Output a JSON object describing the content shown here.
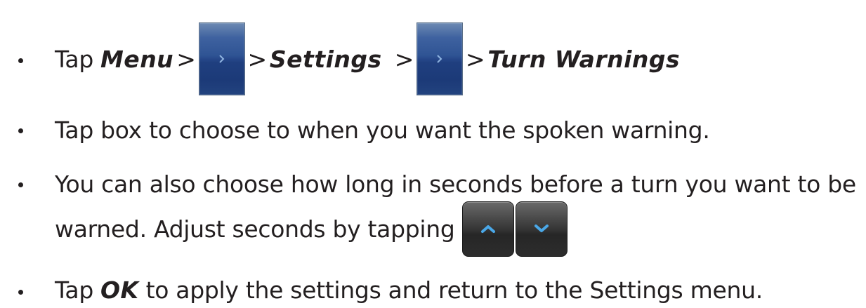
{
  "bullets": [
    {
      "tap": "Tap",
      "menu": "Menu",
      "gt1": ">",
      "gt2": ">",
      "settings": "Settings",
      "gt3": ">",
      "gt4": ">",
      "turn_warnings": "Turn Warnings"
    },
    {
      "text": "Tap box to  choose to when you want the spoken warning."
    },
    {
      "line1": "You can also choose how long in seconds before a turn you want to be",
      "line2": "warned. Adjust seconds by tapping"
    },
    {
      "tap": "Tap",
      "ok": "OK",
      "rest": "to apply the settings and return to the Settings menu."
    }
  ],
  "icons": {
    "chevron_button": "chevron-right-icon",
    "up_button": "chevron-up-icon",
    "down_button": "chevron-down-icon"
  },
  "colors": {
    "text": "#231f20",
    "chevron_button_blue": "#2f5494",
    "arrow_button_dark": "#333333",
    "arrow_glyph_blue": "#4aa8e8"
  }
}
